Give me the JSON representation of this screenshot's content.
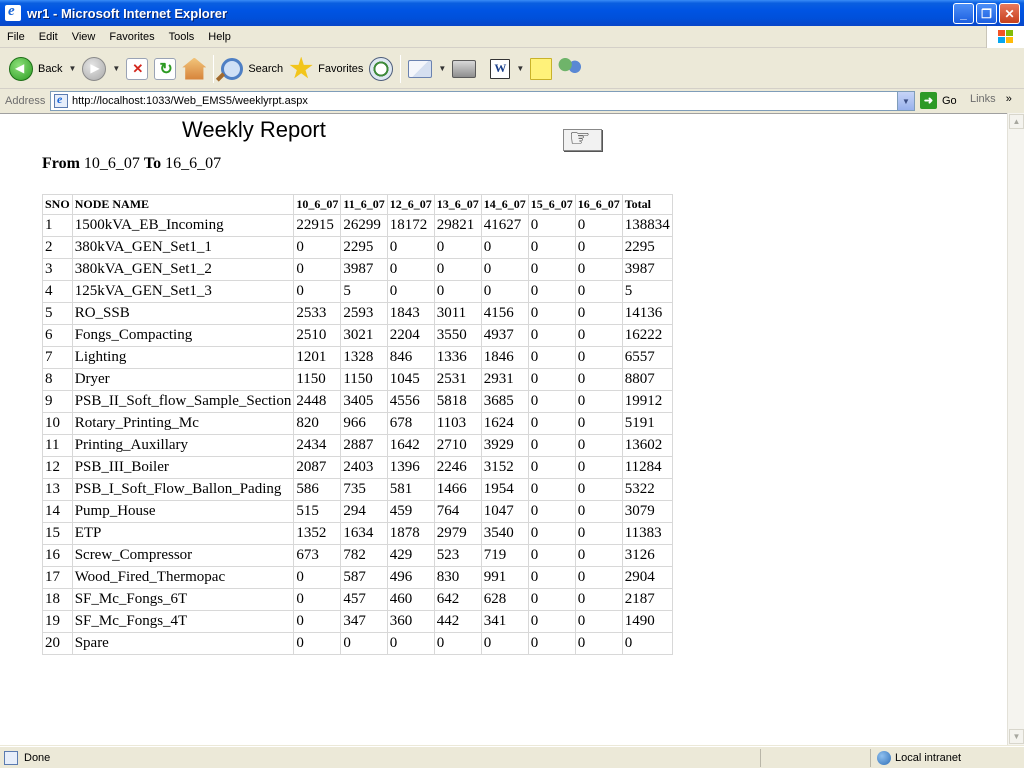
{
  "window": {
    "title": "wr1 - Microsoft Internet Explorer"
  },
  "menu": [
    "File",
    "Edit",
    "View",
    "Favorites",
    "Tools",
    "Help"
  ],
  "toolbar": {
    "back_label": "Back",
    "search_label": "Search",
    "favorites_label": "Favorites"
  },
  "address": {
    "label": "Address",
    "url": "http://localhost:1033/Web_EMS5/weeklyrpt.aspx",
    "go_label": "Go",
    "links_label": "Links",
    "more": "»"
  },
  "report": {
    "title": "Weekly Report",
    "from_label": "From",
    "from_value": "10_6_07",
    "to_label": "To",
    "to_value": "16_6_07",
    "headers": [
      "SNO",
      "NODE NAME",
      "10_6_07",
      "11_6_07",
      "12_6_07",
      "13_6_07",
      "14_6_07",
      "15_6_07",
      "16_6_07",
      "Total"
    ],
    "rows": [
      [
        "1",
        "1500kVA_EB_Incoming",
        "22915",
        "26299",
        "18172",
        "29821",
        "41627",
        "0",
        "0",
        "138834"
      ],
      [
        "2",
        "380kVA_GEN_Set1_1",
        "0",
        "2295",
        "0",
        "0",
        "0",
        "0",
        "0",
        "2295"
      ],
      [
        "3",
        "380kVA_GEN_Set1_2",
        "0",
        "3987",
        "0",
        "0",
        "0",
        "0",
        "0",
        "3987"
      ],
      [
        "4",
        "125kVA_GEN_Set1_3",
        "0",
        "5",
        "0",
        "0",
        "0",
        "0",
        "0",
        "5"
      ],
      [
        "5",
        "RO_SSB",
        "2533",
        "2593",
        "1843",
        "3011",
        "4156",
        "0",
        "0",
        "14136"
      ],
      [
        "6",
        "Fongs_Compacting",
        "2510",
        "3021",
        "2204",
        "3550",
        "4937",
        "0",
        "0",
        "16222"
      ],
      [
        "7",
        "Lighting",
        "1201",
        "1328",
        "846",
        "1336",
        "1846",
        "0",
        "0",
        "6557"
      ],
      [
        "8",
        "Dryer",
        "1150",
        "1150",
        "1045",
        "2531",
        "2931",
        "0",
        "0",
        "8807"
      ],
      [
        "9",
        "PSB_II_Soft_flow_Sample_Section",
        "2448",
        "3405",
        "4556",
        "5818",
        "3685",
        "0",
        "0",
        "19912"
      ],
      [
        "10",
        "Rotary_Printing_Mc",
        "820",
        "966",
        "678",
        "1103",
        "1624",
        "0",
        "0",
        "5191"
      ],
      [
        "11",
        "Printing_Auxillary",
        "2434",
        "2887",
        "1642",
        "2710",
        "3929",
        "0",
        "0",
        "13602"
      ],
      [
        "12",
        "PSB_III_Boiler",
        "2087",
        "2403",
        "1396",
        "2246",
        "3152",
        "0",
        "0",
        "11284"
      ],
      [
        "13",
        "PSB_I_Soft_Flow_Ballon_Pading",
        "586",
        "735",
        "581",
        "1466",
        "1954",
        "0",
        "0",
        "5322"
      ],
      [
        "14",
        "Pump_House",
        "515",
        "294",
        "459",
        "764",
        "1047",
        "0",
        "0",
        "3079"
      ],
      [
        "15",
        "ETP",
        "1352",
        "1634",
        "1878",
        "2979",
        "3540",
        "0",
        "0",
        "11383"
      ],
      [
        "16",
        "Screw_Compressor",
        "673",
        "782",
        "429",
        "523",
        "719",
        "0",
        "0",
        "3126"
      ],
      [
        "17",
        "Wood_Fired_Thermopac",
        "0",
        "587",
        "496",
        "830",
        "991",
        "0",
        "0",
        "2904"
      ],
      [
        "18",
        "SF_Mc_Fongs_6T",
        "0",
        "457",
        "460",
        "642",
        "628",
        "0",
        "0",
        "2187"
      ],
      [
        "19",
        "SF_Mc_Fongs_4T",
        "0",
        "347",
        "360",
        "442",
        "341",
        "0",
        "0",
        "1490"
      ],
      [
        "20",
        "Spare",
        "0",
        "0",
        "0",
        "0",
        "0",
        "0",
        "0",
        "0"
      ]
    ]
  },
  "status": {
    "text": "Done",
    "zone": "Local intranet"
  },
  "colors": {
    "titlebar": "#0054e3",
    "chrome": "#ece9d8"
  }
}
